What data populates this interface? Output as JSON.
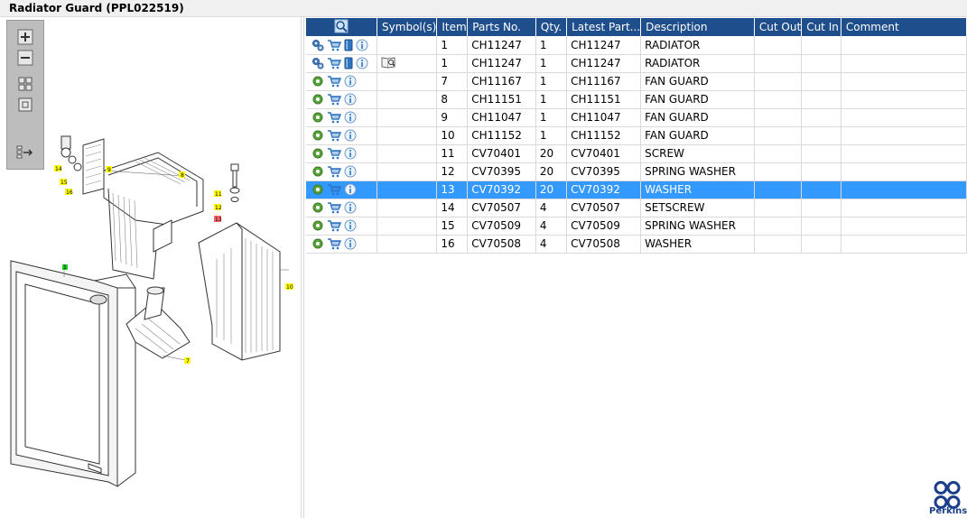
{
  "window": {
    "title": "Radiator Guard (PPL022519)"
  },
  "toolbar": {
    "buttons": [
      {
        "name": "zoom-in-button",
        "icon": "plus-box-icon"
      },
      {
        "name": "zoom-out-button",
        "icon": "minus-box-icon"
      },
      {
        "name": "fit-all-button",
        "icon": "grid-icon"
      },
      {
        "name": "fit-window-button",
        "icon": "square-icon"
      },
      {
        "name": "export-button",
        "icon": "list-arrow-icon"
      }
    ]
  },
  "diagram": {
    "callouts": [
      "14",
      "15",
      "16",
      "9",
      "8",
      "11",
      "12",
      "13",
      "10",
      "1",
      "7"
    ]
  },
  "table": {
    "headers": [
      "",
      "Symbol(s)",
      "Item",
      "Parts No.",
      "Qty.",
      "Latest Part...",
      "Description",
      "Cut Out",
      "Cut In",
      "Comment"
    ],
    "rows": [
      {
        "action_icons": [
          "gears-icon",
          "cart-icon",
          "book-icon",
          "info-icon"
        ],
        "symbol": "",
        "item": "1",
        "part_no": "CH11247",
        "qty": "1",
        "latest": "CH11247",
        "description": "RADIATOR",
        "cut_out": "",
        "cut_in": "",
        "comment": ""
      },
      {
        "action_icons": [
          "gears-icon",
          "cart-icon",
          "book-icon",
          "info-icon"
        ],
        "symbol": "book-magnifier-icon",
        "item": "1",
        "part_no": "CH11247",
        "qty": "1",
        "latest": "CH11247",
        "description": "RADIATOR",
        "cut_out": "",
        "cut_in": "",
        "comment": ""
      },
      {
        "action_icons": [
          "gear-icon",
          "cart-icon",
          "info-icon"
        ],
        "symbol": "",
        "item": "7",
        "part_no": "CH11167",
        "qty": "1",
        "latest": "CH11167",
        "description": "FAN GUARD",
        "cut_out": "",
        "cut_in": "",
        "comment": ""
      },
      {
        "action_icons": [
          "gear-icon",
          "cart-icon",
          "info-icon"
        ],
        "symbol": "",
        "item": "8",
        "part_no": "CH11151",
        "qty": "1",
        "latest": "CH11151",
        "description": "FAN GUARD",
        "cut_out": "",
        "cut_in": "",
        "comment": ""
      },
      {
        "action_icons": [
          "gear-icon",
          "cart-icon",
          "info-icon"
        ],
        "symbol": "",
        "item": "9",
        "part_no": "CH11047",
        "qty": "1",
        "latest": "CH11047",
        "description": "FAN GUARD",
        "cut_out": "",
        "cut_in": "",
        "comment": ""
      },
      {
        "action_icons": [
          "gear-icon",
          "cart-icon",
          "info-icon"
        ],
        "symbol": "",
        "item": "10",
        "part_no": "CH11152",
        "qty": "1",
        "latest": "CH11152",
        "description": "FAN GUARD",
        "cut_out": "",
        "cut_in": "",
        "comment": ""
      },
      {
        "action_icons": [
          "gear-icon",
          "cart-icon",
          "info-icon"
        ],
        "symbol": "",
        "item": "11",
        "part_no": "CV70401",
        "qty": "20",
        "latest": "CV70401",
        "description": "SCREW",
        "cut_out": "",
        "cut_in": "",
        "comment": ""
      },
      {
        "action_icons": [
          "gear-icon",
          "cart-icon",
          "info-icon"
        ],
        "symbol": "",
        "item": "12",
        "part_no": "CV70395",
        "qty": "20",
        "latest": "CV70395",
        "description": "SPRING WASHER",
        "cut_out": "",
        "cut_in": "",
        "comment": ""
      },
      {
        "action_icons": [
          "gear-icon",
          "cart-icon",
          "info-icon"
        ],
        "symbol": "",
        "item": "13",
        "part_no": "CV70392",
        "qty": "20",
        "latest": "CV70392",
        "description": "WASHER",
        "cut_out": "",
        "cut_in": "",
        "comment": "",
        "selected": true
      },
      {
        "action_icons": [
          "gear-icon",
          "cart-icon",
          "info-icon"
        ],
        "symbol": "",
        "item": "14",
        "part_no": "CV70507",
        "qty": "4",
        "latest": "CV70507",
        "description": "SETSCREW",
        "cut_out": "",
        "cut_in": "",
        "comment": ""
      },
      {
        "action_icons": [
          "gear-icon",
          "cart-icon",
          "info-icon"
        ],
        "symbol": "",
        "item": "15",
        "part_no": "CV70509",
        "qty": "4",
        "latest": "CV70509",
        "description": "SPRING WASHER",
        "cut_out": "",
        "cut_in": "",
        "comment": ""
      },
      {
        "action_icons": [
          "gear-icon",
          "cart-icon",
          "info-icon"
        ],
        "symbol": "",
        "item": "16",
        "part_no": "CV70508",
        "qty": "4",
        "latest": "CV70508",
        "description": "WASHER",
        "cut_out": "",
        "cut_in": "",
        "comment": ""
      }
    ]
  },
  "brand": {
    "name": "Perkins",
    "color": "#1b3e8a"
  },
  "colors": {
    "header_bg": "#1f4e8c",
    "selected_row": "#3399ff",
    "callout_yellow": "#ffff00",
    "callout_green": "#22cc22",
    "callout_red": "#ff6666"
  }
}
